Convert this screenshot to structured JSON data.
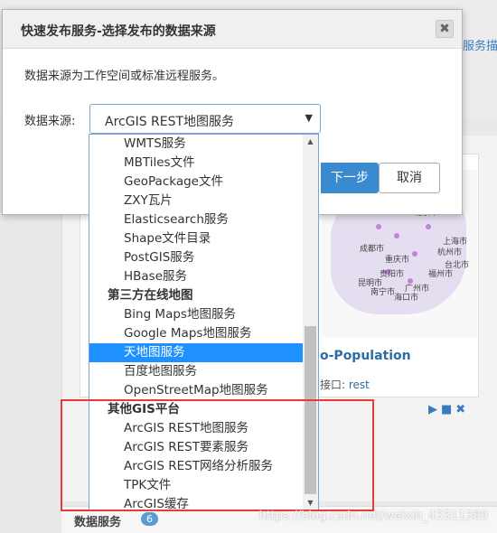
{
  "background": {
    "link_text": "服务描",
    "map_labels": [
      "成都市",
      "重庆市",
      "杭州市",
      "上海市",
      "北京市",
      "贵阳市",
      "昆明市",
      "南宁市",
      "广州市",
      "海口市",
      "福州市",
      "台北市"
    ],
    "card_title": "o-Population",
    "interface_label": "接口:",
    "interface_value": "rest",
    "footer_label": "数据服务",
    "footer_count": "6",
    "watermark": "https://blog.csdn.net/weixin_43311389"
  },
  "dialog": {
    "title": "快速发布服务-选择发布的数据来源",
    "close": "✖",
    "description": "数据来源为工作空间或标准远程服务。",
    "source_label": "数据来源:",
    "selected_value": "ArcGIS REST地图服务",
    "next_button": "下一步",
    "cancel_button": "取消"
  },
  "dropdown": {
    "items": [
      {
        "type": "option",
        "label": "WMTS服务"
      },
      {
        "type": "option",
        "label": "MBTiles文件"
      },
      {
        "type": "option",
        "label": "GeoPackage文件"
      },
      {
        "type": "option",
        "label": "ZXY瓦片"
      },
      {
        "type": "option",
        "label": "Elasticsearch服务"
      },
      {
        "type": "option",
        "label": "Shape文件目录"
      },
      {
        "type": "option",
        "label": "PostGIS服务"
      },
      {
        "type": "option",
        "label": "HBase服务"
      },
      {
        "type": "group",
        "label": "第三方在线地图"
      },
      {
        "type": "option",
        "label": "Bing Maps地图服务"
      },
      {
        "type": "option",
        "label": "Google Maps地图服务"
      },
      {
        "type": "option",
        "label": "天地图服务",
        "selected": true
      },
      {
        "type": "option",
        "label": "百度地图服务"
      },
      {
        "type": "option",
        "label": "OpenStreetMap地图服务"
      },
      {
        "type": "group",
        "label": "其他GIS平台"
      },
      {
        "type": "option",
        "label": "ArcGIS REST地图服务"
      },
      {
        "type": "option",
        "label": "ArcGIS REST要素服务"
      },
      {
        "type": "option",
        "label": "ArcGIS REST网络分析服务"
      },
      {
        "type": "option",
        "label": "TPK文件"
      },
      {
        "type": "option",
        "label": "ArcGIS缓存"
      }
    ]
  },
  "colors": {
    "accent": "#3a8ad0",
    "selected": "#1e90ff",
    "highlight_box": "#e83a3a"
  }
}
